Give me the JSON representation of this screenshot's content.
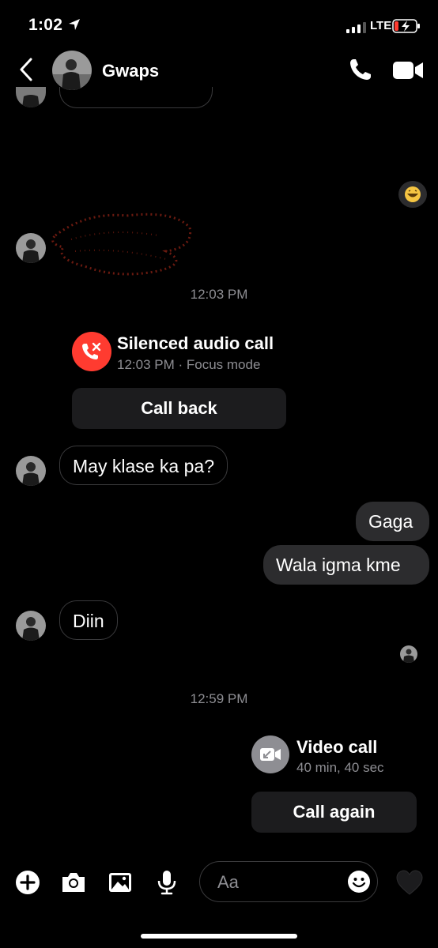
{
  "status_bar": {
    "time": "1:02",
    "network": "LTE"
  },
  "header": {
    "contact_name": "Gwaps"
  },
  "messages": {
    "timestamp_1": "12:03 PM",
    "missed_call": {
      "title": "Silenced audio call",
      "subtitle": "12:03 PM · Focus mode",
      "button_label": "Call back"
    },
    "in_1": "May klase ka pa?",
    "out_1": "Gaga",
    "out_2": "Wala igma kme",
    "in_2": "Diin",
    "timestamp_2": "12:59 PM",
    "video_call": {
      "title": "Video call",
      "subtitle": "40 min, 40 sec",
      "button_label": "Call again"
    }
  },
  "composer": {
    "placeholder": "Aa"
  },
  "colors": {
    "missed_call_red": "#ff3b30",
    "bubble_out": "#2c2c2e",
    "call_button_bg": "#1c1c1e"
  }
}
